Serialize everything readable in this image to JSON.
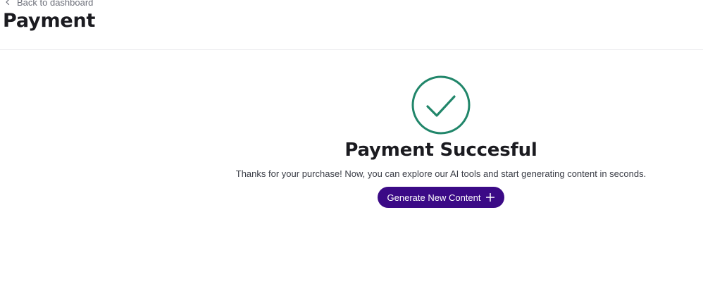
{
  "header": {
    "back_label": "Back to dashboard",
    "title": "Payment"
  },
  "success": {
    "icon": "check-circle-icon",
    "title": "Payment Succesful",
    "message": "Thanks for your purchase! Now, you can explore our AI tools and start generating content in seconds.",
    "cta_label": "Generate New Content",
    "cta_icon": "plus-icon"
  },
  "colors": {
    "accent": "#3b0a86",
    "success": "#21866a",
    "text": "#1b1b20",
    "muted": "#6b6e78"
  }
}
